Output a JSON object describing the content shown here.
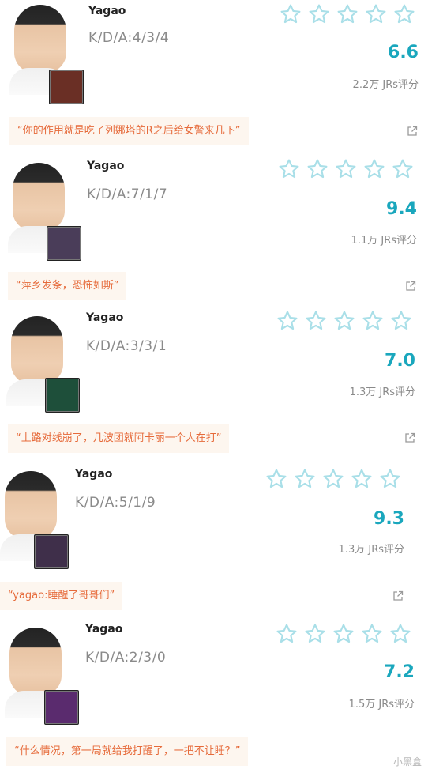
{
  "colors": {
    "accent": "#1aa7bd",
    "star": "#a9dfe8",
    "comment_text": "#e66a3a",
    "comment_bg": "#fdf6ef"
  },
  "cards": [
    {
      "player": "Yagao",
      "kda": "K/D/A:4/3/4",
      "score": "6.6",
      "votes": "2.2万 JRs评分",
      "comment": "“你的作用就是吃了列娜塔的R之后给女警来几下”",
      "champ_color": "#6a2f25",
      "stars_count": 5
    },
    {
      "player": "Yagao",
      "kda": "K/D/A:7/1/7",
      "score": "9.4",
      "votes": "1.1万 JRs评分",
      "comment": "“萍乡发条，恐怖如斯”",
      "champ_color": "#4a3d59",
      "stars_count": 5
    },
    {
      "player": "Yagao",
      "kda": "K/D/A:3/3/1",
      "score": "7.0",
      "votes": "1.3万 JRs评分",
      "comment": "“上路对线崩了，几波团就阿卡丽一个人在打”",
      "champ_color": "#1e4f3a",
      "stars_count": 5
    },
    {
      "player": "Yagao",
      "kda": "K/D/A:5/1/9",
      "score": "9.3",
      "votes": "1.3万 JRs评分",
      "comment": "“yagao:睡醒了哥哥们”",
      "champ_color": "#3f2f4a",
      "stars_count": 5
    },
    {
      "player": "Yagao",
      "kda": "K/D/A:2/3/0",
      "score": "7.2",
      "votes": "1.5万 JRs评分",
      "comment": "“什么情况，第一局就给我打醒了，一把不让睡？”",
      "champ_color": "#5a2b6e",
      "stars_count": 5
    }
  ],
  "watermark": "小黑盒"
}
